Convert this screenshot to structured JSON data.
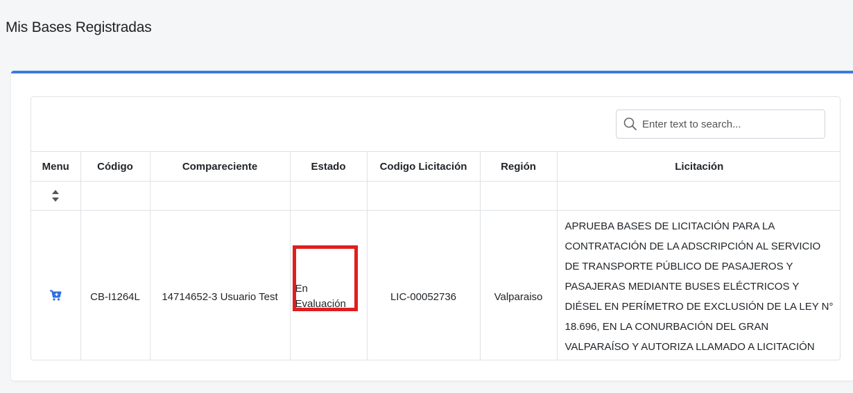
{
  "page": {
    "title": "Mis Bases Registradas"
  },
  "search": {
    "placeholder": "Enter text to search...",
    "value": ""
  },
  "table": {
    "headers": {
      "menu": "Menu",
      "codigo": "Código",
      "compareciente": "Compareciente",
      "estado": "Estado",
      "codigo_licitacion": "Codigo Licitación",
      "region": "Región",
      "licitacion": "Licitación"
    },
    "rows": [
      {
        "menu_icon": "cart-icon",
        "codigo": "CB-I1264L",
        "compareciente": "14714652-3 Usuario Test",
        "estado_line1": "En",
        "estado_line2": "Evaluación",
        "codigo_licitacion": "LIC-00052736",
        "region": "Valparaiso",
        "licitacion": "APRUEBA BASES DE LICITACIÓN PARA LA CONTRATACIÓN DE LA ADSCRIPCIÓN AL SERVICIO DE TRANSPORTE PÚBLICO DE PASAJEROS Y PASAJERAS MEDIANTE BUSES ELÉCTRICOS Y DIÉSEL EN PERÍMETRO DE EXCLUSIÓN DE LA LEY N° 18.696, EN LA CONURBACIÓN DEL GRAN VALPARAÍSO Y AUTORIZA LLAMADO A LICITACIÓN PÚBLICA."
      }
    ]
  },
  "colors": {
    "accent": "#3c7be0",
    "highlight": "#e01e1e",
    "cart_icon": "#2f6fe0"
  }
}
